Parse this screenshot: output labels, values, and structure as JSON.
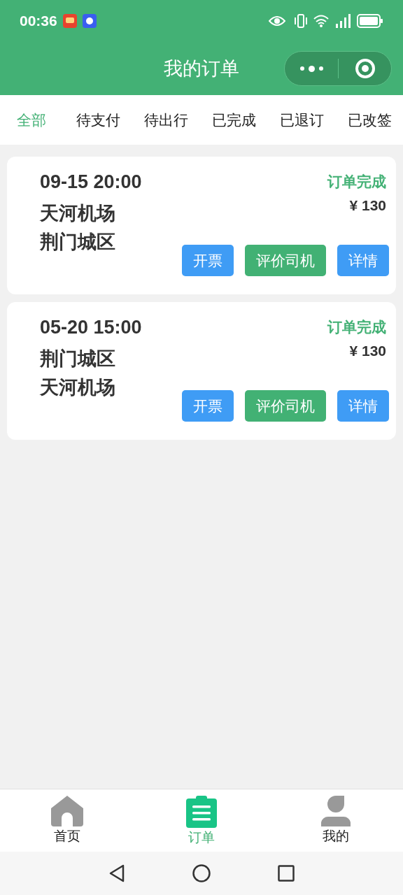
{
  "status_bar": {
    "time": "00:36"
  },
  "header": {
    "title": "我的订单"
  },
  "tabs": [
    {
      "label": "全部",
      "selected": true
    },
    {
      "label": "待支付",
      "selected": false
    },
    {
      "label": "待出行",
      "selected": false
    },
    {
      "label": "已完成",
      "selected": false
    },
    {
      "label": "已退订",
      "selected": false
    },
    {
      "label": "已改签",
      "selected": false
    }
  ],
  "orders": [
    {
      "time": "09-15 20:00",
      "from": "天河机场",
      "to": "荆门城区",
      "status": "订单完成",
      "price": "¥ 130",
      "buttons": [
        {
          "label": "开票",
          "kind": "invoice"
        },
        {
          "label": "评价司机",
          "kind": "rate"
        },
        {
          "label": "详情",
          "kind": "detail"
        }
      ]
    },
    {
      "time": "05-20 15:00",
      "from": "荆门城区",
      "to": "天河机场",
      "status": "订单完成",
      "price": "¥ 130",
      "buttons": [
        {
          "label": "开票",
          "kind": "invoice"
        },
        {
          "label": "评价司机",
          "kind": "rate"
        },
        {
          "label": "详情",
          "kind": "detail"
        }
      ]
    }
  ],
  "bottom_nav": [
    {
      "label": "首页",
      "kind": "home",
      "selected": false
    },
    {
      "label": "订单",
      "kind": "orders",
      "selected": true
    },
    {
      "label": "我的",
      "kind": "profile",
      "selected": false
    }
  ]
}
